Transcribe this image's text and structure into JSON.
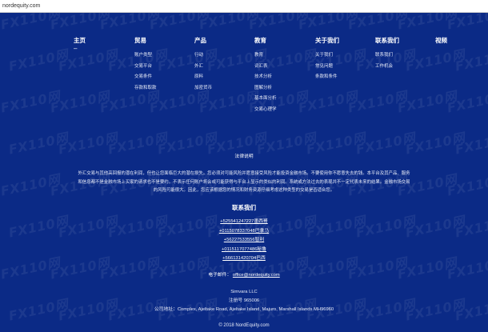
{
  "browser": {
    "url": "nordequity.com"
  },
  "watermark": {
    "text": "FX110网"
  },
  "nav": {
    "home": {
      "label": "主页",
      "dash": "–"
    },
    "columns": [
      {
        "title": "贸易",
        "items": [
          "账户类型",
          "交易平台",
          "交易条件",
          "存款和取款"
        ]
      },
      {
        "title": "产品",
        "items": [
          "行动",
          "外汇",
          "原料",
          "加密货币"
        ]
      },
      {
        "title": "教育",
        "items": [
          "教育",
          "词汇表",
          "技术分析",
          "图解分析",
          "基本面分析",
          "交易心理学"
        ]
      },
      {
        "title": "关于我们",
        "items": [
          "关于我们",
          "常见问题",
          "条款和条件"
        ]
      },
      {
        "title": "联系我们",
        "items": [
          "联系我们",
          "工作机会"
        ]
      },
      {
        "title": "视频",
        "items": []
      }
    ]
  },
  "legal": {
    "title": "法律说明",
    "text": "外汇交易与其他高回报的潜在利润，但也让您面临巨大的潜在损失。您必须对可能风险并愿意接受风险才能投资金融市场。不要使用你不愿意失去的钱。本平台及其产品、服务和信息都不是金融市场上买家的请求也不是要约。不表示任何账户将会或可能获得与平台上显示的类似的利润。系统或方法过去的表现并不一定代表未来的结果。金融市场交易的风险可能很大。因此，您应该根据您的情况和财务资源仔细考虑这种类型的交易是否适合您。"
  },
  "contact": {
    "title": "联系我们",
    "phones": [
      "+525541247227墨西哥",
      "+011507833704​8巴拿马",
      "+56227533556智利",
      "+011511707748​6秘鲁",
      "+5661314207​04巴西"
    ],
    "email_label": "电子邮件：",
    "email": "office@nordequity.com"
  },
  "company": {
    "name": "Simvara LLC",
    "reg": "注册号 965006",
    "address": "公司地址：Complex, Ajeltake Road, Ajeltake Island, Majuro, Marshall Islands MH96960"
  },
  "copyright": "© 2018 NordEquity.com"
}
